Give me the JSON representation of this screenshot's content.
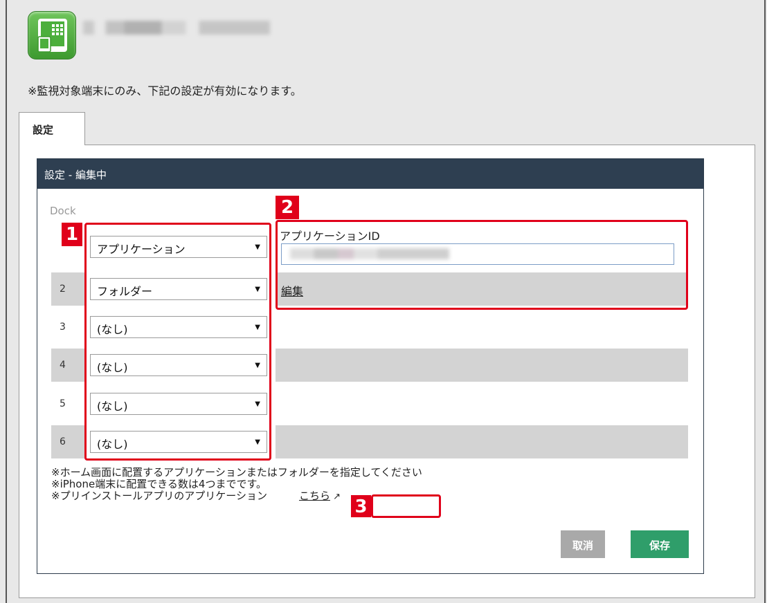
{
  "header": {
    "app_icon": "tablet-app-icon",
    "notice": "※監視対象端末にのみ、下記の設定が有効になります。"
  },
  "tabs": [
    {
      "label": "設定",
      "active": true
    }
  ],
  "panel": {
    "title": "設定 - 編集中",
    "dock_label": "Dock",
    "app_id_label": "アプリケーションID",
    "edit_link": "編集",
    "rows": [
      {
        "num": "",
        "value": "アプリケーション"
      },
      {
        "num": "2",
        "value": "フォルダー"
      },
      {
        "num": "3",
        "value": "(なし)"
      },
      {
        "num": "4",
        "value": "(なし)"
      },
      {
        "num": "5",
        "value": "(なし)"
      },
      {
        "num": "6",
        "value": "(なし)"
      }
    ],
    "notes": [
      "※ホーム画面に配置するアプリケーションまたはフォルダーを指定してください",
      "※iPhone端末に配置できる数は4つまでです。",
      "※プリインストールアプリのアプリケーション"
    ],
    "link_text": "こちら",
    "cancel_label": "取消",
    "save_label": "保存"
  },
  "callouts": [
    "1",
    "2",
    "3"
  ],
  "colors": {
    "panel_header": "#2e3f51",
    "save_button": "#2f9e6a",
    "cancel_button": "#a9a9a9",
    "callout": "#e0001a"
  }
}
